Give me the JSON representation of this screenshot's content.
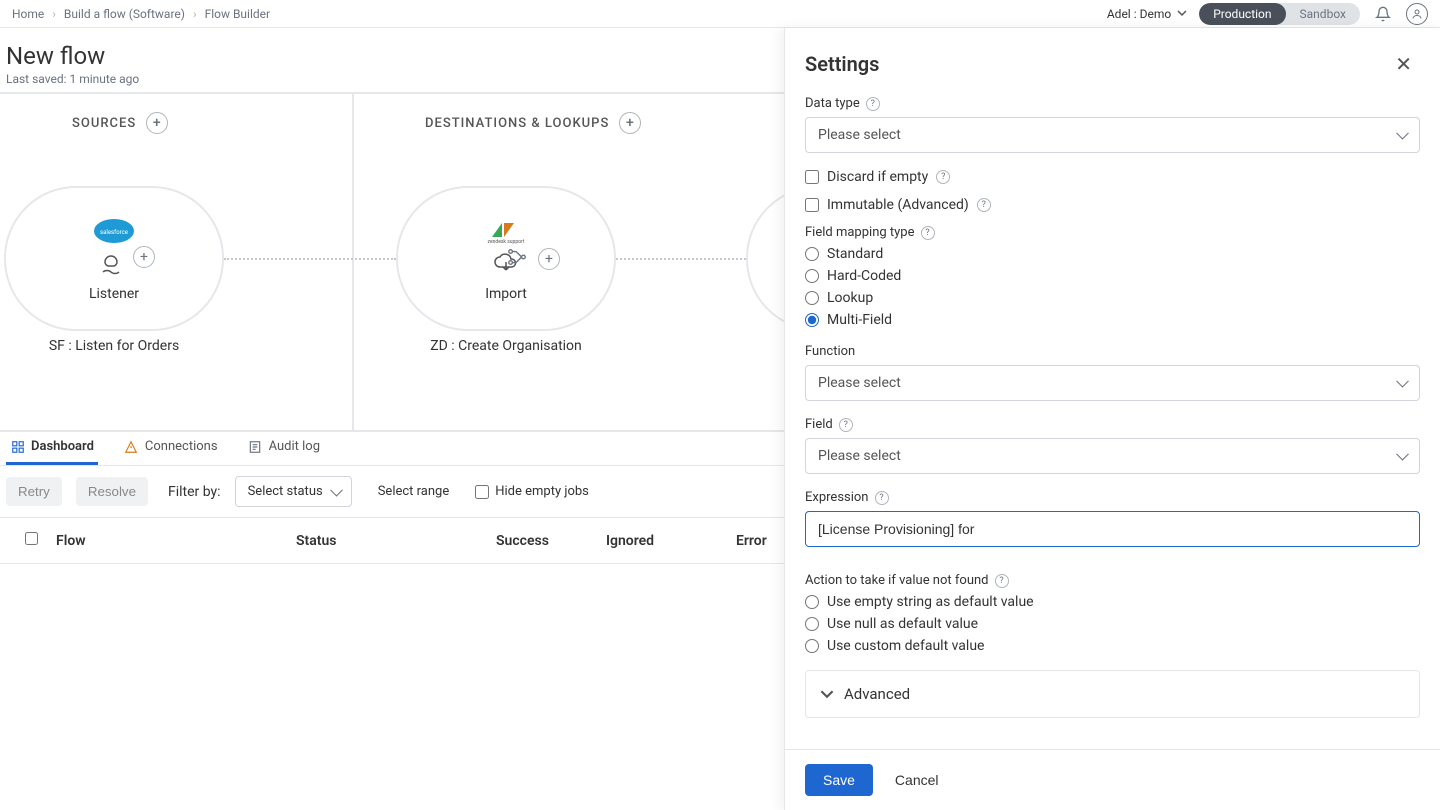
{
  "breadcrumb": {
    "home": "Home",
    "parent": "Build a flow (Software)",
    "current": "Flow Builder"
  },
  "user": {
    "label": "Adel : Demo"
  },
  "env": {
    "production": "Production",
    "sandbox": "Sandbox"
  },
  "page": {
    "title": "New flow",
    "saved": "Last saved: 1 minute ago"
  },
  "lanes": {
    "sources": "SOURCES",
    "destinations": "DESTINATIONS & LOOKUPS"
  },
  "nodes": {
    "source": {
      "name": "Listener",
      "label": "SF : Listen for Orders"
    },
    "dest": {
      "name": "Import",
      "label": "ZD : Create Organisation"
    }
  },
  "tabs": {
    "dashboard": "Dashboard",
    "connections": "Connections",
    "audit": "Audit log"
  },
  "toolbar": {
    "retry": "Retry",
    "resolve": "Resolve",
    "filter_by": "Filter by:",
    "select_status": "Select status",
    "select_range": "Select range",
    "hide_empty": "Hide empty jobs"
  },
  "table": {
    "flow": "Flow",
    "status": "Status",
    "success": "Success",
    "ignored": "Ignored",
    "error": "Error"
  },
  "panel": {
    "title": "Settings",
    "data_type": {
      "label": "Data type",
      "placeholder": "Please select"
    },
    "discard": "Discard if empty",
    "immutable": "Immutable (Advanced)",
    "mapping_type": {
      "label": "Field mapping type",
      "options": {
        "standard": "Standard",
        "hardcoded": "Hard-Coded",
        "lookup": "Lookup",
        "multifield": "Multi-Field"
      },
      "selected": "multifield"
    },
    "function": {
      "label": "Function",
      "placeholder": "Please select"
    },
    "field": {
      "label": "Field",
      "placeholder": "Please select"
    },
    "expression": {
      "label": "Expression",
      "value": "[License Provisioning] for "
    },
    "action_not_found": {
      "label": "Action to take if value not found",
      "options": {
        "empty": "Use empty string as default value",
        "null": "Use null as default value",
        "custom": "Use custom default value"
      }
    },
    "advanced": "Advanced",
    "save": "Save",
    "cancel": "Cancel"
  }
}
